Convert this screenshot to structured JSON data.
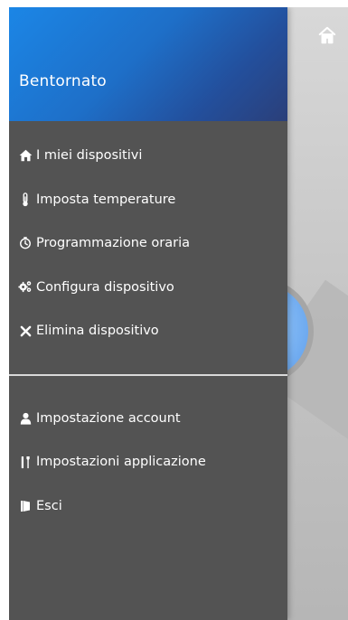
{
  "drawer": {
    "title": "Bentornato",
    "items_top": [
      {
        "label": "I miei dispositivi",
        "icon": "home-icon"
      },
      {
        "label": "Imposta temperature",
        "icon": "thermometer-icon"
      },
      {
        "label": "Programmazione oraria",
        "icon": "timer-icon"
      },
      {
        "label": "Configura dispositivo",
        "icon": "gears-icon"
      },
      {
        "label": "Elimina dispositivo",
        "icon": "close-icon"
      }
    ],
    "items_bottom": [
      {
        "label": "Impostazione account",
        "icon": "user-icon"
      },
      {
        "label": "Impostazioni applicazione",
        "icon": "tools-icon"
      },
      {
        "label": "Esci",
        "icon": "exit-door-icon"
      }
    ]
  },
  "background": {
    "home_icon": "home-icon"
  },
  "colors": {
    "drawer_bg": "#535353",
    "header_gradient_start": "#1b86e6",
    "header_gradient_end": "#2b3f79",
    "divider": "#d9d9d9",
    "text": "#ffffff"
  }
}
